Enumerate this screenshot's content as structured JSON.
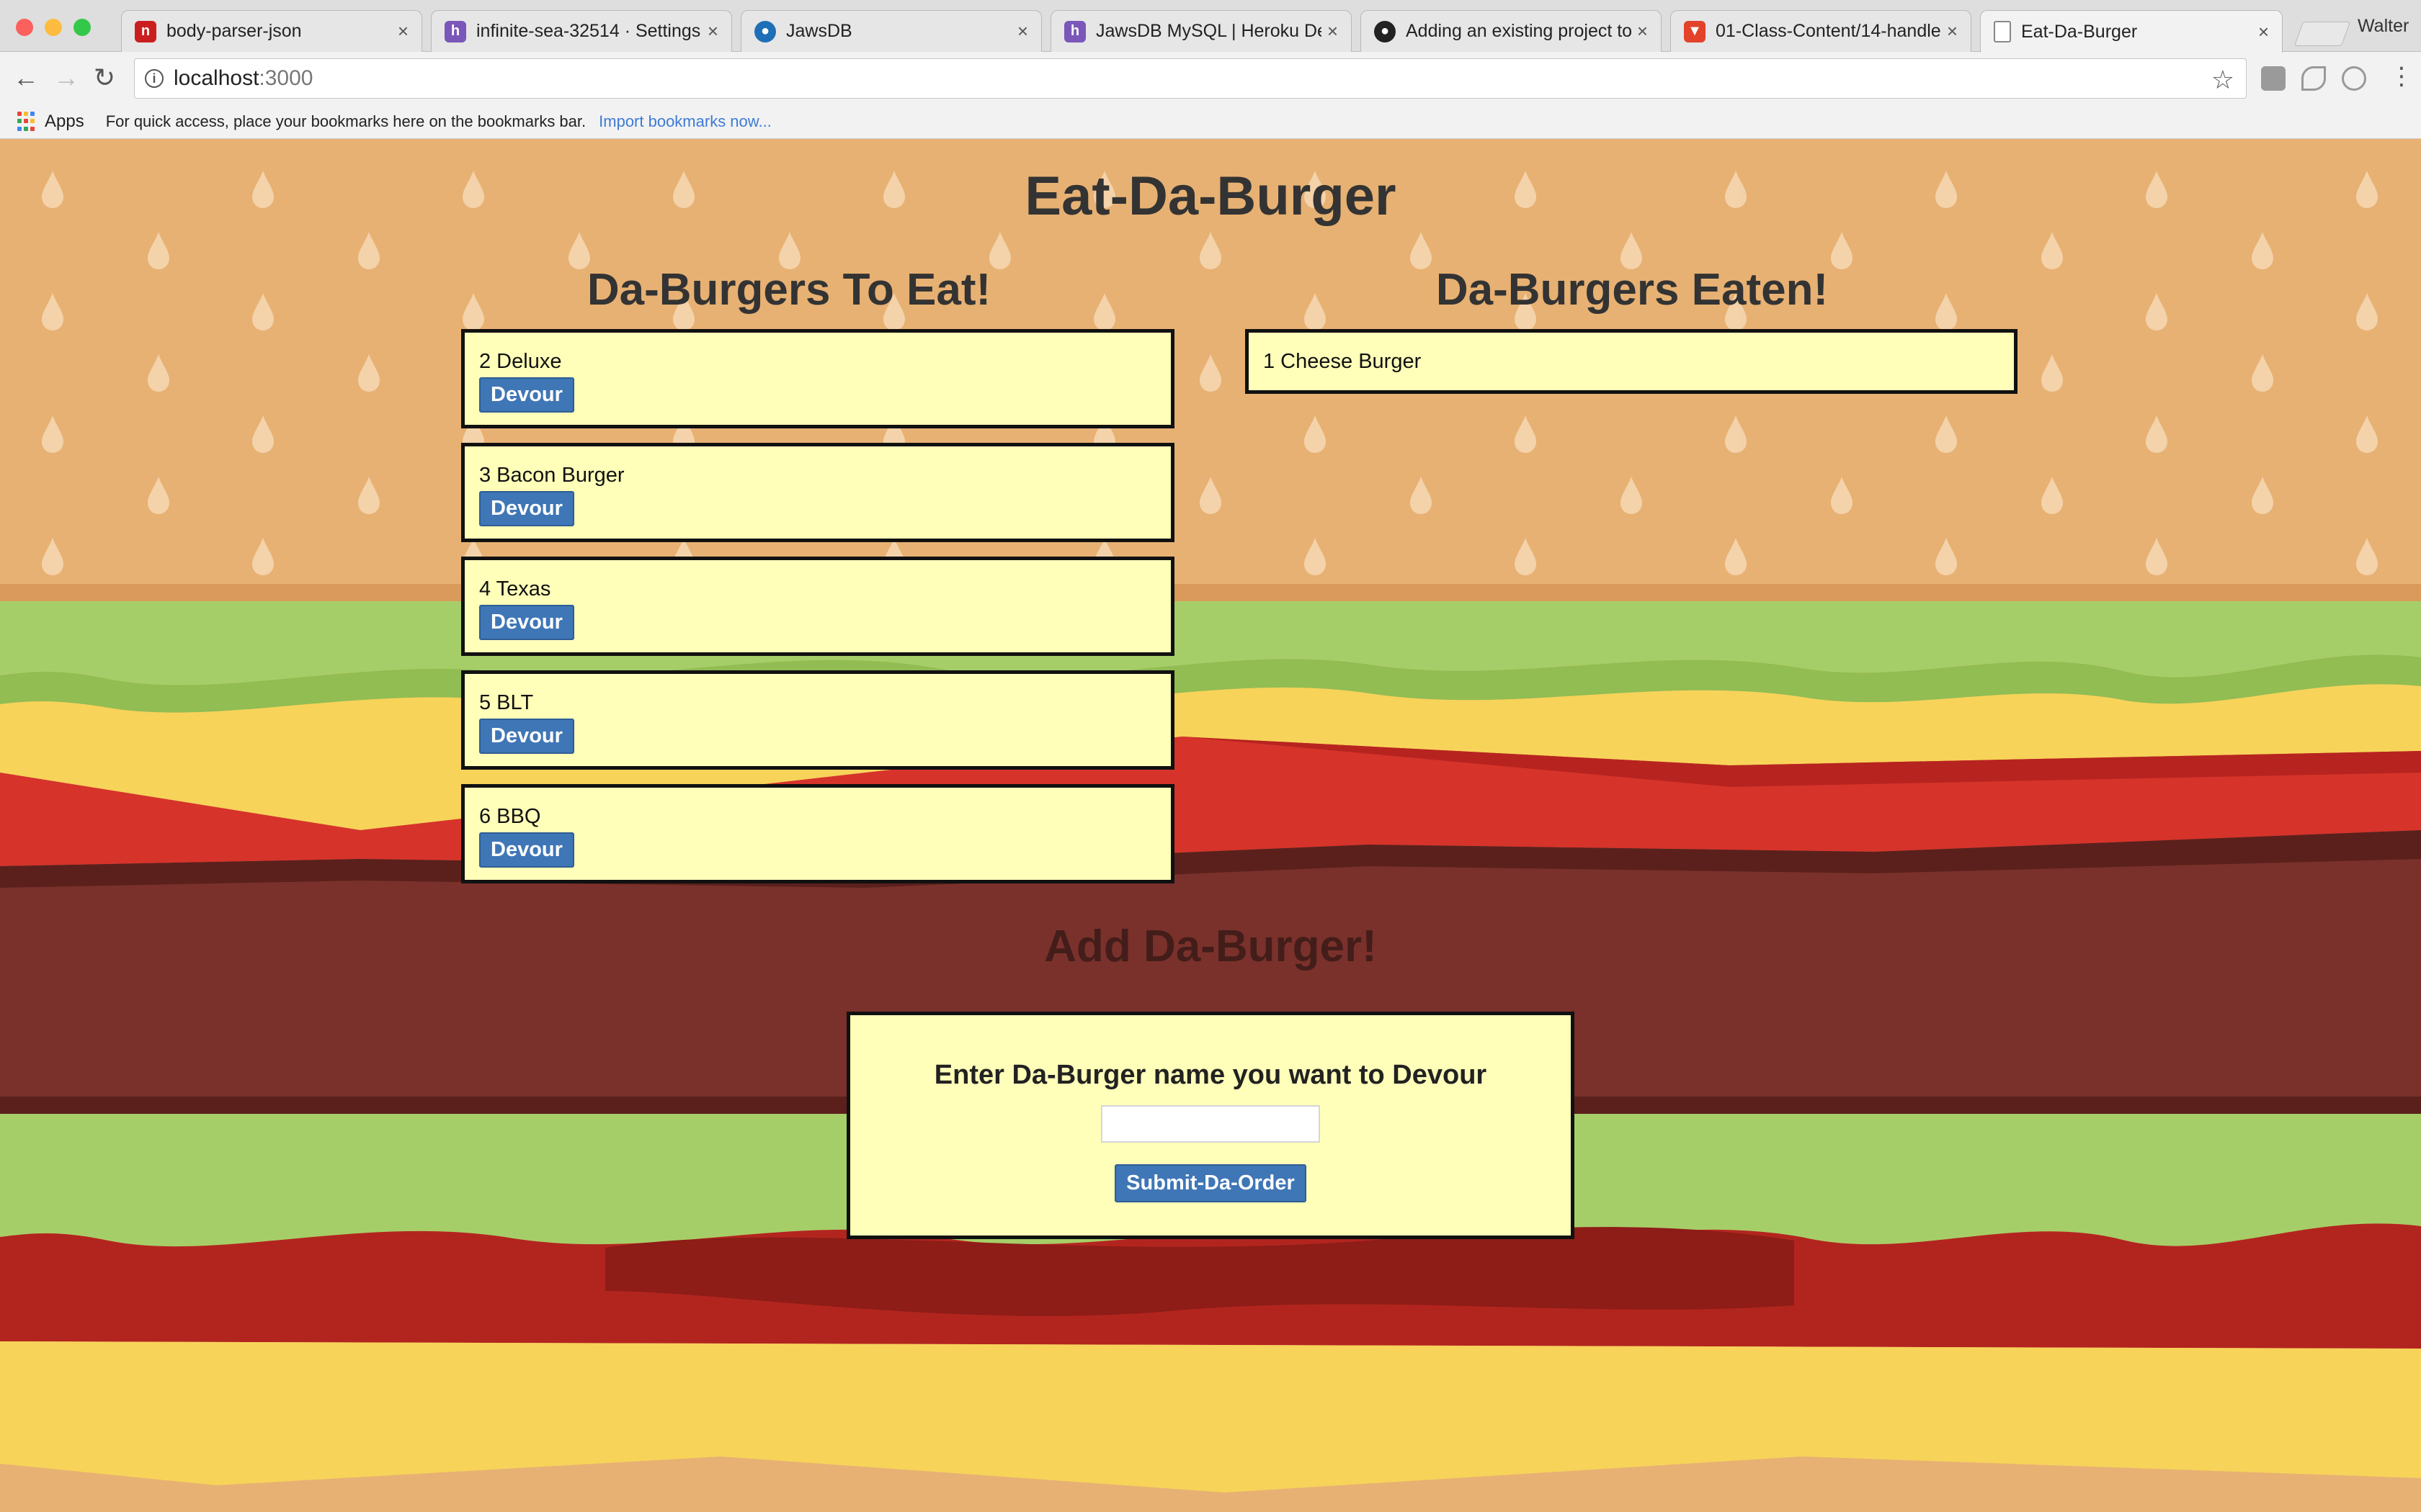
{
  "browser": {
    "tabs": [
      {
        "title": "body-parser-json",
        "favicon": "npm-icon",
        "color": "#cb1f1f",
        "active": false
      },
      {
        "title": "infinite-sea-32514 · Settings",
        "favicon": "heroku-icon",
        "color": "#7a57b8",
        "active": false
      },
      {
        "title": "JawsDB",
        "favicon": "jawsdb-icon",
        "color": "#1f6fb7",
        "active": false
      },
      {
        "title": "JawsDB MySQL | Heroku Dev",
        "favicon": "heroku-icon",
        "color": "#7a57b8",
        "active": false
      },
      {
        "title": "Adding an existing project to",
        "favicon": "github-icon",
        "color": "#222222",
        "active": false
      },
      {
        "title": "01-Class-Content/14-handle",
        "favicon": "gitlab-icon",
        "color": "#e2432a",
        "active": false
      },
      {
        "title": "Eat-Da-Burger",
        "favicon": "document-icon",
        "color": "#888888",
        "active": true
      }
    ],
    "profile_name": "Walter",
    "url_host": "localhost",
    "url_port": ":3000",
    "bookmarks": {
      "apps_label": "Apps",
      "message": "For quick access, place your bookmarks here on the bookmarks bar.",
      "import_link": "Import bookmarks now..."
    }
  },
  "page": {
    "title": "Eat-Da-Burger",
    "to_eat_heading": "Da-Burgers To Eat!",
    "eaten_heading": "Da-Burgers Eaten!",
    "devour_label": "Devour",
    "burgers_to_eat": [
      {
        "name": "2 Deluxe"
      },
      {
        "name": "3 Bacon Burger"
      },
      {
        "name": "4 Texas"
      },
      {
        "name": "5 BLT"
      },
      {
        "name": "6 BBQ"
      }
    ],
    "burgers_eaten": [
      {
        "name": "1 Cheese Burger"
      }
    ],
    "add_heading": "Add Da-Burger!",
    "form_label": "Enter Da-Burger name you want to Devour",
    "input_value": "",
    "submit_label": "Submit-Da-Order"
  },
  "colors": {
    "bun": "#e7b173",
    "lettuce": "#a6ce68",
    "cheese": "#f7d35a",
    "tomato": "#d6332b",
    "patty": "#7a312b",
    "card": "#ffffb9",
    "button": "#3f76b6"
  }
}
